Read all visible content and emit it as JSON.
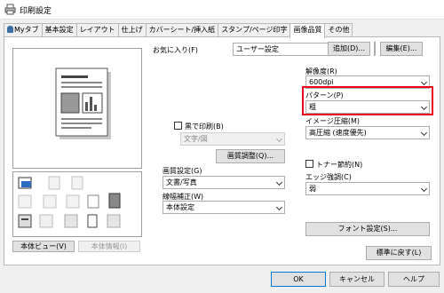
{
  "window": {
    "title": "印刷設定"
  },
  "tabs": [
    "Myタブ",
    "基本設定",
    "レイアウト",
    "仕上げ",
    "カバーシート/挿入紙",
    "スタンプ/ページ印字",
    "画像品質",
    "その他"
  ],
  "favorites": {
    "label": "お気に入り(F)",
    "value": "ユーザー設定",
    "add_label": "追加(D)...",
    "edit_label": "編集(E)..."
  },
  "left": {
    "view_button": "本体ビュー(V)",
    "info_button": "本体情報(I)"
  },
  "middle": {
    "mono_label": "黒で印刷(B)",
    "mono_value": "文字/図",
    "quality_button": "画質調整(Q)...",
    "image_setting_label": "画質設定(G)",
    "image_setting_value": "文書/写真",
    "line_label": "線幅補正(W)",
    "line_value": "本体設定"
  },
  "right": {
    "resolution_label": "解像度(R)",
    "resolution_value": "600dpi",
    "pattern_label": "パターン(P)",
    "pattern_value": "粗",
    "compression_label": "イメージ圧縮(M)",
    "compression_value": "高圧縮 (速度優先)",
    "toner_label": "トナー節約(N)",
    "edge_label": "エッジ強調(C)",
    "edge_value": "弱",
    "font_button": "フォント設定(S)...",
    "default_button": "標準に戻す(L)"
  },
  "footer": {
    "ok": "OK",
    "cancel": "キャンセル",
    "help": "ヘルプ"
  },
  "colors": {
    "highlight": "#e8001c"
  }
}
